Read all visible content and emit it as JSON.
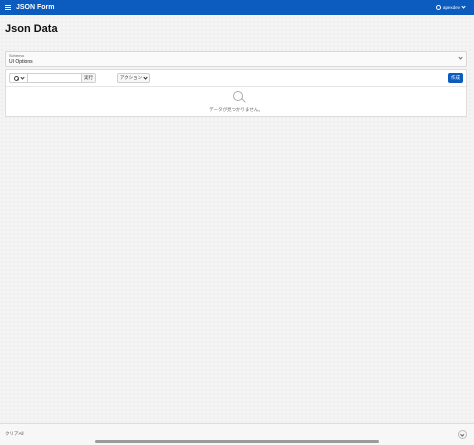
{
  "header": {
    "app_title": "JSON Form",
    "username": "apexdev",
    "menu_icon": "hamburger-icon",
    "user_icon": "user-icon",
    "accent_color": "#0c5bbf"
  },
  "page": {
    "title": "Json Data"
  },
  "schema": {
    "label": "Schema",
    "value": "UI Options"
  },
  "report": {
    "search_placeholder": "",
    "go_label": "実行",
    "actions_label": "アクション",
    "create_label": "作成",
    "no_data_text": "データが見つかりません。"
  },
  "footer": {
    "label": "クリアAll"
  }
}
